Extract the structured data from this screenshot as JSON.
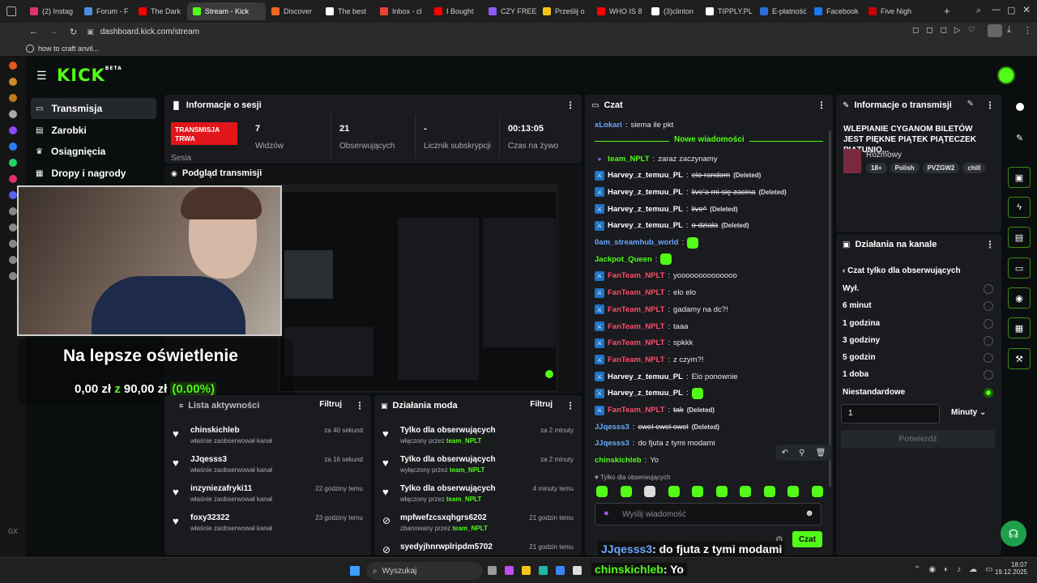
{
  "browser": {
    "tabs": [
      {
        "label": "(2) Instag",
        "color": "#e1306c"
      },
      {
        "label": "Forum - F",
        "color": "#4a90e2"
      },
      {
        "label": "The Dark",
        "color": "#ff0000"
      },
      {
        "label": "Stream - Kick",
        "color": "#53fc18"
      },
      {
        "label": "Discover",
        "color": "#f26522"
      },
      {
        "label": "The best",
        "color": "#ffffff"
      },
      {
        "label": "Inbox - cl",
        "color": "#ea4335"
      },
      {
        "label": "I Bought",
        "color": "#ff0000"
      },
      {
        "label": "CZY FREE",
        "color": "#8b5cf6"
      },
      {
        "label": "Prześlij o",
        "color": "#f5c518"
      },
      {
        "label": "WHO IS 8",
        "color": "#ff0000"
      },
      {
        "label": "(3)clinton",
        "color": "#ffffff"
      },
      {
        "label": "TIPPLY.PL",
        "color": "#ffffff"
      },
      {
        "label": "E-płatność",
        "color": "#2a6fdb"
      },
      {
        "label": "Facebook",
        "color": "#1877f2"
      },
      {
        "label": "Five Nigh",
        "color": "#cc0000"
      }
    ],
    "url": "dashboard.kick.com/stream",
    "bookmark": "how to craft anvil..."
  },
  "sidebar": {
    "items": [
      {
        "label": "Transmisja",
        "icon": "broadcast-icon"
      },
      {
        "label": "Zarobki",
        "icon": "wallet-icon"
      },
      {
        "label": "Osiągnięcia",
        "icon": "trophy-icon"
      },
      {
        "label": "Dropy i nagrody",
        "icon": "gift-icon"
      }
    ]
  },
  "session": {
    "title": "Informacje o sesji",
    "live_badge": "TRANSMISJA TRWA",
    "session_label": "Sesia",
    "stats": [
      {
        "value": "7",
        "label": "Widzów"
      },
      {
        "value": "21",
        "label": "Obserwujących"
      },
      {
        "value": "-",
        "label": "Licznik subskrypcji"
      },
      {
        "value": "00:13:05",
        "label": "Czas na żywo"
      }
    ]
  },
  "preview": {
    "title": "Podgląd transmisji",
    "overlay_text": "Na lepsze oświetlenie",
    "goal_current": "0,00 zł",
    "goal_sep": "z",
    "goal_target": "90,00 zł",
    "goal_percent": "(0.00%)"
  },
  "activity": {
    "title": "Lista aktywności",
    "filter": "Filtruj",
    "items": [
      {
        "name": "chinskichleb",
        "sub": "właśnie zaobserwował kanał",
        "time": "za 40 sekund"
      },
      {
        "name": "JJqesss3",
        "sub": "właśnie zaobserwował kanał",
        "time": "za 16 sekund"
      },
      {
        "name": "inzyniezafryki11",
        "sub": "właśnie zaobserwował kanał",
        "time": "22 godziny temu"
      },
      {
        "name": "foxy32322",
        "sub": "właśnie zaobserwował kanał",
        "time": "23 godziny temu"
      }
    ]
  },
  "modactions": {
    "title": "Działania moda",
    "filter": "Filtruj",
    "items": [
      {
        "name": "Tylko dla obserwujących",
        "sub": "włączony przez ",
        "who": "team_NPLT",
        "time": "za 2 minuty",
        "icon": "heart-icon"
      },
      {
        "name": "Tylko dla obserwujących",
        "sub": "wyłączony przez ",
        "who": "team_NPLT",
        "time": "za 2 minuty",
        "icon": "heart-icon"
      },
      {
        "name": "Tylko dla obserwujących",
        "sub": "włączony przez ",
        "who": "team_NPLT",
        "time": "4 minuty temu",
        "icon": "heart-icon"
      },
      {
        "name": "mpfwefzcsxqhgrs6202",
        "sub": "zbanowany przez ",
        "who": "team_NPLT",
        "time": "21 godzin temu",
        "icon": "ban-icon"
      },
      {
        "name": "syedyjhnrwplripdm5702",
        "sub": "",
        "who": "",
        "time": "21 godzin temu",
        "icon": "ban-icon"
      }
    ]
  },
  "chat": {
    "title": "Czat",
    "top_user": "xLokari",
    "top_text": "siema ile pkt",
    "new_messages": "Nowe wiadomości",
    "messages": [
      {
        "user": "team_NPLT",
        "text": "zaraz zaczynamy",
        "color": "#53fc18",
        "deleted": false,
        "badge": "mic"
      },
      {
        "user": "Harvey_z_temuu_PL",
        "text": "elo random",
        "color": "#ffffff",
        "deleted": true
      },
      {
        "user": "Harvey_z_temuu_PL",
        "text": "live'a mi się zacina",
        "color": "#ffffff",
        "deleted": true
      },
      {
        "user": "Harvey_z_temuu_PL",
        "text": "live^",
        "color": "#ffffff",
        "deleted": true
      },
      {
        "user": "Harvey_z_temuu_PL",
        "text": "o działa",
        "color": "#ffffff",
        "deleted": true
      },
      {
        "user": "0am_streamhub_world",
        "text": "",
        "color": "#6aa8ff",
        "deleted": false,
        "badge": "none",
        "emote": true
      },
      {
        "user": "Jackpot_Queen",
        "text": "",
        "color": "#53fc18",
        "deleted": false,
        "badge": "none",
        "emote": true
      },
      {
        "user": "FanTeam_NPLT",
        "text": "yoooooooooooooo",
        "color": "#ff4d6a",
        "deleted": false
      },
      {
        "user": "FanTeam_NPLT",
        "text": "elo elo",
        "color": "#ff4d6a",
        "deleted": false
      },
      {
        "user": "FanTeam_NPLT",
        "text": "gadamy na dc?!",
        "color": "#ff4d6a",
        "deleted": false
      },
      {
        "user": "FanTeam_NPLT",
        "text": "taaa",
        "color": "#ff4d6a",
        "deleted": false
      },
      {
        "user": "FanTeam_NPLT",
        "text": "spkkk",
        "color": "#ff4d6a",
        "deleted": false
      },
      {
        "user": "FanTeam_NPLT",
        "text": "z czym?!",
        "color": "#ff4d6a",
        "deleted": false
      },
      {
        "user": "Harvey_z_temuu_PL",
        "text": "Elo ponownie",
        "color": "#ffffff",
        "deleted": false
      },
      {
        "user": "Harvey_z_temuu_PL",
        "text": "",
        "color": "#ffffff",
        "deleted": false,
        "emote": true
      },
      {
        "user": "FanTeam_NPLT",
        "text": "tak",
        "color": "#ff4d6a",
        "deleted": true
      },
      {
        "user": "JJqesss3",
        "text": "cwel cwel cwel",
        "color": "#6aa8ff",
        "deleted": true,
        "badge": "none"
      },
      {
        "user": "JJqesss3",
        "text": "do fjuta z tymi modami",
        "color": "#6aa8ff",
        "deleted": false,
        "badge": "none"
      },
      {
        "user": "chinskichleb",
        "text": "Yo",
        "color": "#53fc18",
        "deleted": false,
        "badge": "none"
      }
    ],
    "deleted_label": "(Deleted)",
    "followers_only": "Tylko dla obserwujących",
    "input_placeholder": "Wyślij wiadomość",
    "send": "Czat"
  },
  "streaminfo": {
    "title": "Informacje o transmisji",
    "stream_title": "WLEPIANIE CYGANOM BILETÓW JEST PIĘKNE PIĄTEK PIĄTECZEK PIĄTUNIO...",
    "category": "Rozmowy",
    "tags": [
      "18+",
      "Polish",
      "PVZGW2",
      "chill"
    ]
  },
  "channelactions": {
    "title": "Działania na kanale",
    "back": "Czat tylko dla obserwujących",
    "options": [
      "Wył.",
      "6 minut",
      "1 godzina",
      "3 godziny",
      "5 godzin",
      "1 doba",
      "Niestandardowe"
    ],
    "selected": "Niestandardowe",
    "custom_value": "1",
    "unit": "Minuty",
    "confirm": "Potwierdź"
  },
  "overlay": {
    "line1_user": "JJqesss3",
    "line1_text": ": do fjuta z tymi modami",
    "line2_user": "chinskichleb",
    "line2_text": ": Yo"
  },
  "taskbar": {
    "search": "Wyszukaj",
    "time": "18:07",
    "date": "19.12.2025"
  }
}
